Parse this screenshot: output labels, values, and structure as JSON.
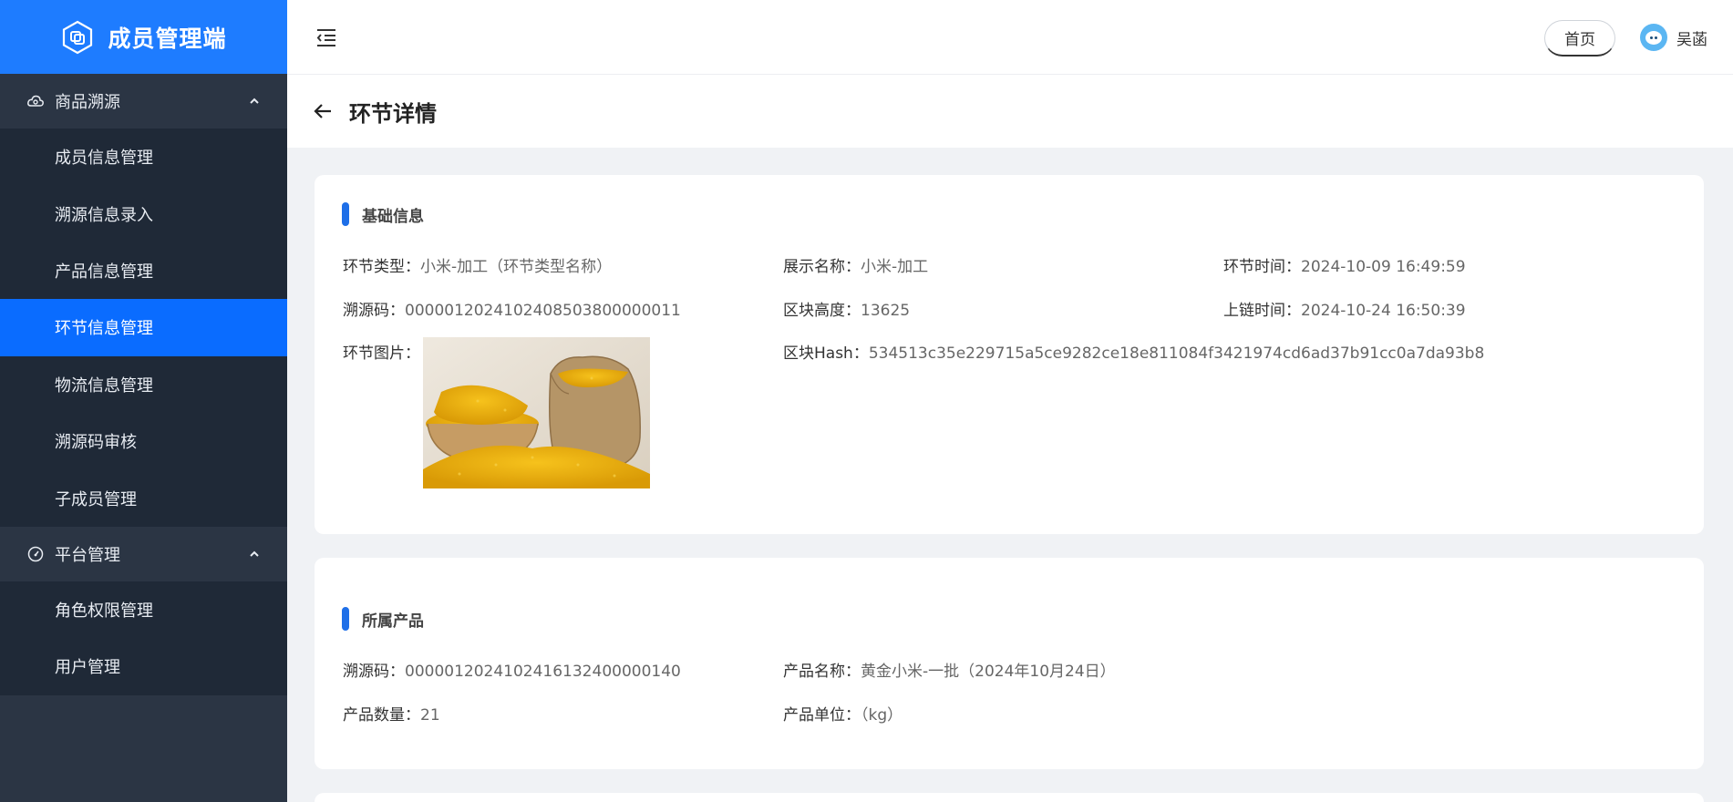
{
  "app": {
    "title": "成员管理端"
  },
  "sidebar": {
    "groups": [
      {
        "label": "商品溯源",
        "items": [
          {
            "label": "成员信息管理"
          },
          {
            "label": "溯源信息录入"
          },
          {
            "label": "产品信息管理"
          },
          {
            "label": "环节信息管理"
          },
          {
            "label": "物流信息管理"
          },
          {
            "label": "溯源码审核"
          },
          {
            "label": "子成员管理"
          }
        ]
      },
      {
        "label": "平台管理",
        "items": [
          {
            "label": "角色权限管理"
          },
          {
            "label": "用户管理"
          }
        ]
      }
    ],
    "active_item": "环节信息管理"
  },
  "header": {
    "home_label": "首页",
    "user_name": "吴菡"
  },
  "page": {
    "title": "环节详情"
  },
  "basic_info": {
    "title": "基础信息",
    "stage_type": {
      "label": "环节类型：",
      "value": "小米-加工（环节类型名称）"
    },
    "display_name": {
      "label": "展示名称：",
      "value": "小米-加工"
    },
    "stage_time": {
      "label": "环节时间：",
      "value": "2024-10-09 16:49:59"
    },
    "trace_code": {
      "label": "溯源码：",
      "value": "0000012024102408503800000011"
    },
    "block_height": {
      "label": "区块高度：",
      "value": "13625"
    },
    "chain_time": {
      "label": "上链时间：",
      "value": "2024-10-24 16:50:39"
    },
    "stage_image": {
      "label": "环节图片："
    },
    "block_hash": {
      "label": "区块Hash：",
      "value": "534513c35e229715a5ce9282ce18e811084f3421974cd6ad37b91cc0a7da93b8"
    }
  },
  "product_info": {
    "title": "所属产品",
    "trace_code": {
      "label": "溯源码：",
      "value": "0000012024102416132400000140"
    },
    "product_name": {
      "label": "产品名称：",
      "value": "黄金小米-一批（2024年10月24日）"
    },
    "quantity": {
      "label": "产品数量：",
      "value": "21"
    },
    "unit": {
      "label": "产品单位：",
      "value": "（kg）"
    }
  },
  "colors": {
    "brand": "#1e7cff",
    "active": "#0a6cff",
    "sidebar_bg": "#2b3544",
    "submenu_bg": "#1f2937",
    "section_bar": "#1e6fe8"
  },
  "icons": [
    "logo-icon",
    "cloud-icon",
    "gauge-icon",
    "chevron-up-icon",
    "menu-fold-icon",
    "back-arrow-icon",
    "avatar-icon"
  ]
}
